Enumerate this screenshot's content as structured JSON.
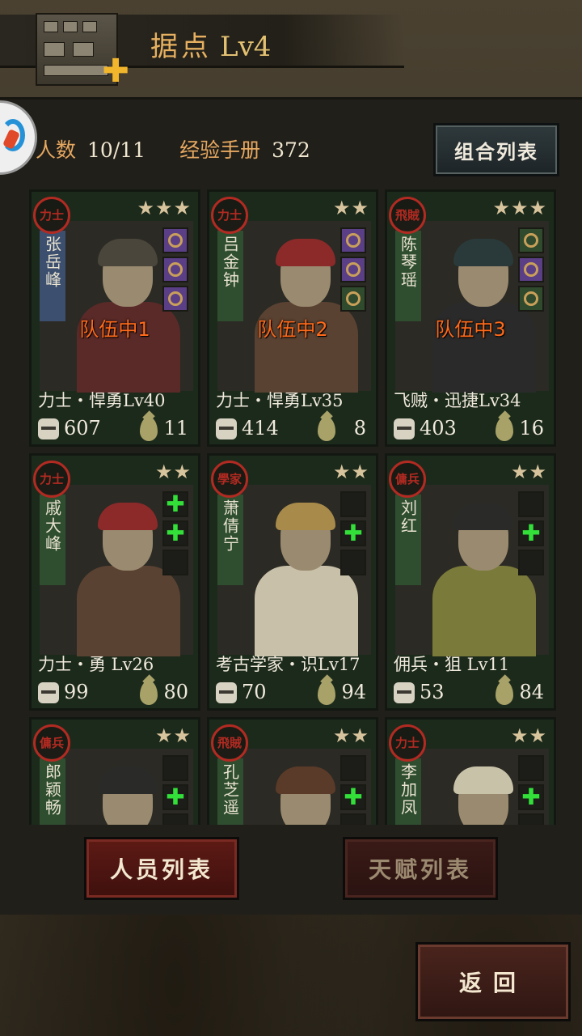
{
  "header": {
    "title": "据点",
    "level": "Lv4",
    "plus_icon": "plus-icon"
  },
  "stats": {
    "people_label": "人数",
    "people_value": "10/11",
    "exp_label": "经验手册",
    "exp_value": "372"
  },
  "buttons": {
    "combo_list": "组合列表",
    "people_list": "人员列表",
    "talent_list": "天赋列表",
    "back": "返回"
  },
  "cards": [
    {
      "seal": "力士",
      "stars": "★★★",
      "name": "张岳峰",
      "strip": "blue",
      "team": "队伍中1",
      "class_line": "力士・悍勇Lv40",
      "atk": "607",
      "hp": "11",
      "slots": [
        "purple",
        "purple",
        "purple"
      ]
    },
    {
      "seal": "力士",
      "stars": "★★",
      "name": "吕金钟",
      "strip": "green",
      "team": "队伍中2",
      "class_line": "力士・悍勇Lv35",
      "atk": "414",
      "hp": "8",
      "slots": [
        "purple",
        "purple",
        "green"
      ]
    },
    {
      "seal": "飛賊",
      "stars": "★★★",
      "name": "陈琴瑶",
      "strip": "green",
      "team": "队伍中3",
      "class_line": "飞贼・迅捷Lv34",
      "atk": "403",
      "hp": "16",
      "slots": [
        "green",
        "purple",
        "green"
      ]
    },
    {
      "seal": "力士",
      "stars": "★★",
      "name": "戚大峰",
      "strip": "green",
      "team": "",
      "class_line": "力士・勇 Lv26",
      "atk": "99",
      "hp": "80",
      "slots": [
        "plus",
        "plus",
        "dark"
      ]
    },
    {
      "seal": "學家",
      "stars": "★★",
      "name": "萧倩宁",
      "strip": "green",
      "team": "",
      "class_line": "考古学家・识Lv17",
      "atk": "70",
      "hp": "94",
      "slots": [
        "dark",
        "plus",
        "dark"
      ]
    },
    {
      "seal": "傭兵",
      "stars": "★★",
      "name": "刘红",
      "strip": "green",
      "team": "",
      "class_line": "佣兵・狙 Lv11",
      "atk": "53",
      "hp": "84",
      "slots": [
        "dark",
        "plus",
        "dark"
      ]
    },
    {
      "seal": "傭兵",
      "stars": "★★",
      "name": "郎颖畅",
      "strip": "green",
      "team": "",
      "class_line": "",
      "atk": "",
      "hp": "",
      "slots": [
        "dark",
        "plus",
        "dark"
      ]
    },
    {
      "seal": "飛賊",
      "stars": "★★",
      "name": "孔芝遥",
      "strip": "green",
      "team": "",
      "class_line": "",
      "atk": "",
      "hp": "",
      "slots": [
        "dark",
        "plus",
        "dark"
      ]
    },
    {
      "seal": "力士",
      "stars": "★★",
      "name": "李加凤",
      "strip": "green",
      "team": "",
      "class_line": "",
      "atk": "",
      "hp": "",
      "slots": [
        "dark",
        "plus",
        "dark"
      ]
    }
  ],
  "colors": {
    "accent_orange": "#e6a860",
    "team_label": "#ff6a1a",
    "seal_red": "#b22a22",
    "plus_green": "#33e03a",
    "button_red": "#5e1a15"
  }
}
